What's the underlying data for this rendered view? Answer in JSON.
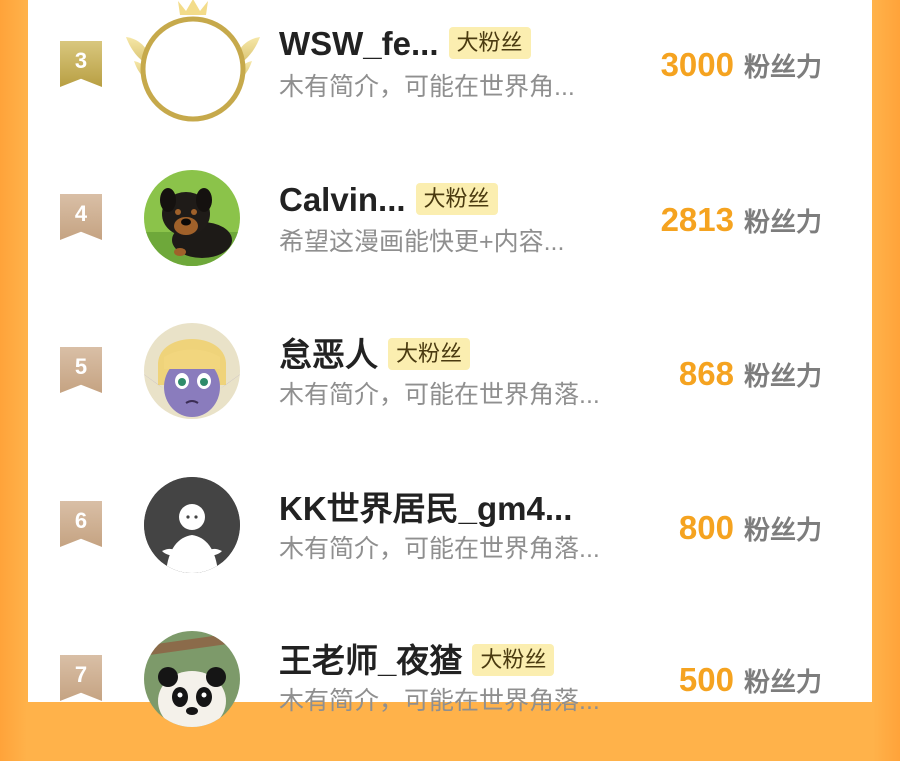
{
  "colors": {
    "page_bg": "#ffb24a",
    "panel_bg": "#ffffff",
    "score_color": "#f5a320",
    "badge_bg": "#fbeeb0",
    "rank_gold": "#c9b15a",
    "rank_plain": "#d1b293"
  },
  "rows": [
    {
      "rank": "3",
      "name": "WSW_fe...",
      "badge": "大粉丝",
      "intro": "木有简介，可能在世界角...",
      "score": "3000",
      "unit": "粉丝力",
      "avatar": "crowned-empty-avatar-icon"
    },
    {
      "rank": "4",
      "name": "Calvin...",
      "badge": "大粉丝",
      "intro": "希望这漫画能快更+内容...",
      "score": "2813",
      "unit": "粉丝力",
      "avatar": "rottweiler-dog-avatar"
    },
    {
      "rank": "5",
      "name": "怠恶人",
      "badge": "大粉丝",
      "intro": "木有简介，可能在世界角落...",
      "score": "868",
      "unit": "粉丝力",
      "avatar": "anime-elf-avatar"
    },
    {
      "rank": "6",
      "name": "KK世界居民_gm4...",
      "badge": "",
      "intro": "木有简介，可能在世界角落...",
      "score": "800",
      "unit": "粉丝力",
      "avatar": "default-user-avatar-icon"
    },
    {
      "rank": "7",
      "name": "王老师_夜猹",
      "badge": "大粉丝",
      "intro": "木有简介，可能在世界角落...",
      "score": "500",
      "unit": "粉丝力",
      "avatar": "panda-avatar"
    }
  ]
}
